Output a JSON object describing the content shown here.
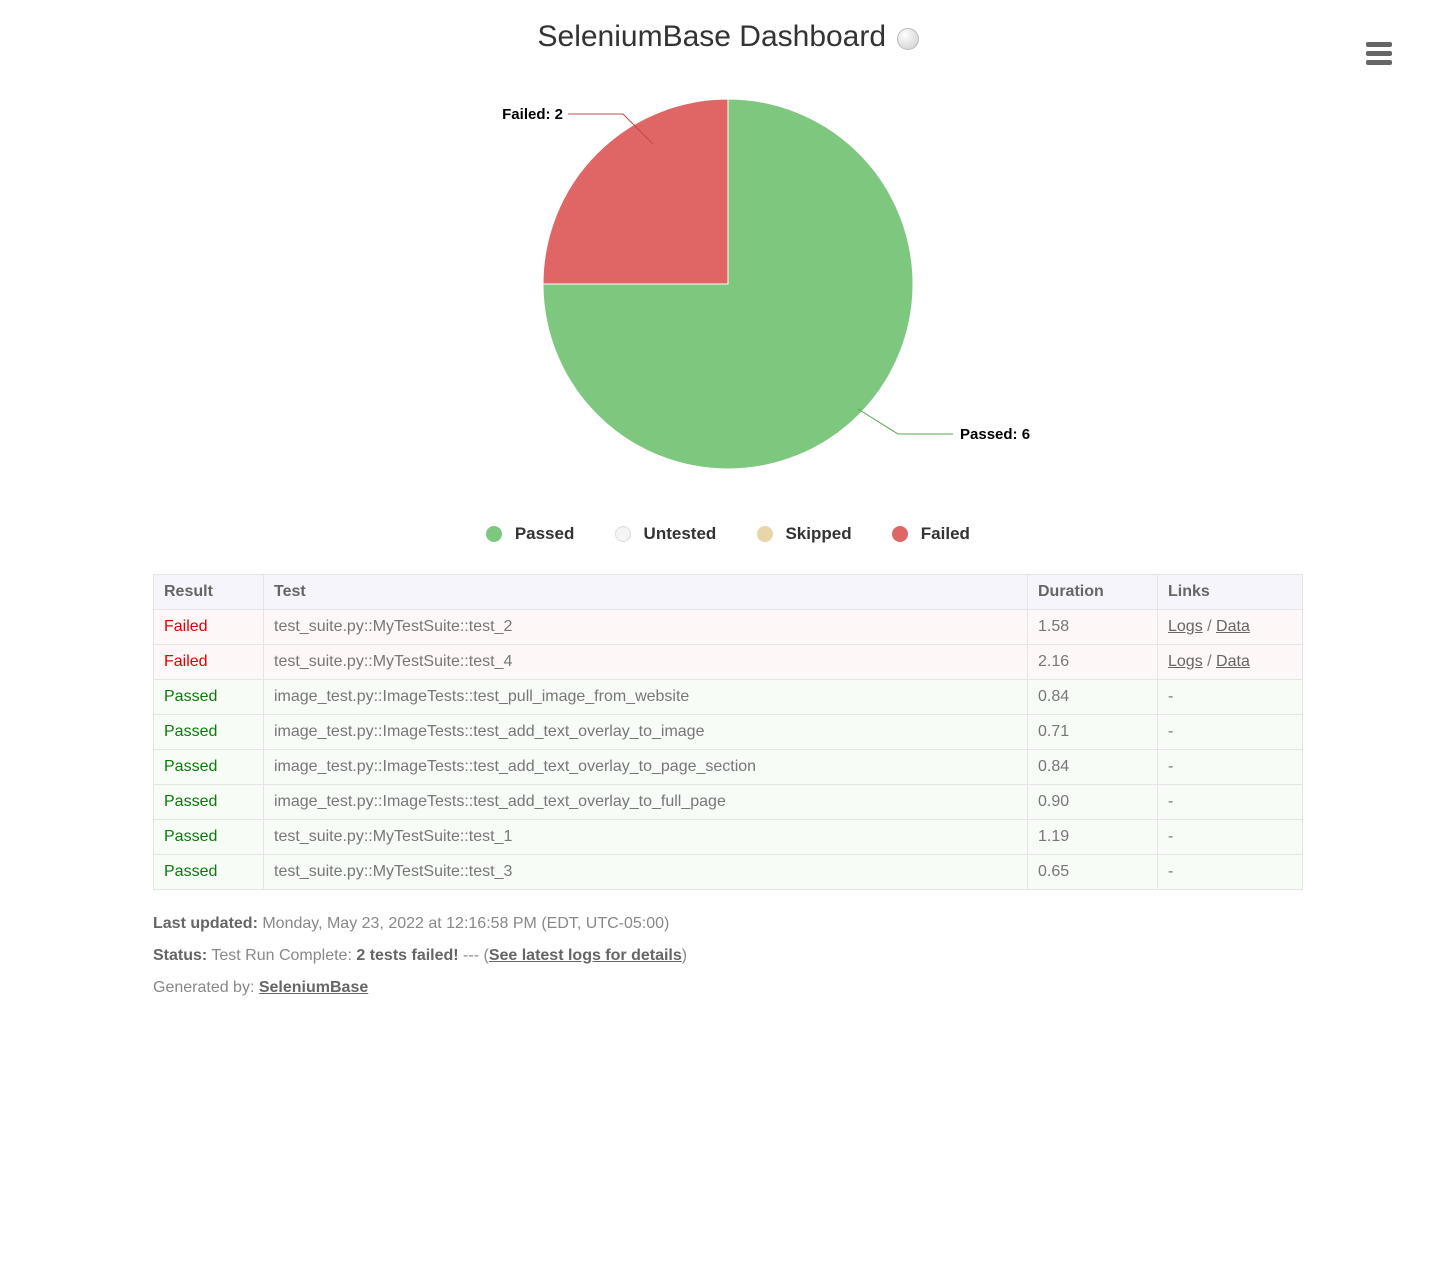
{
  "title": "SeleniumBase Dashboard",
  "chart_data": {
    "type": "pie",
    "title": "SeleniumBase Dashboard",
    "series": [
      {
        "name": "Passed",
        "value": 6,
        "color": "#7ec77e"
      },
      {
        "name": "Untested",
        "value": 0,
        "color": "#f4f4f4"
      },
      {
        "name": "Skipped",
        "value": 0,
        "color": "#e8d5a8"
      },
      {
        "name": "Failed",
        "value": 2,
        "color": "#e06666"
      }
    ],
    "labels": {
      "passed": "Passed: 6",
      "failed": "Failed: 2"
    }
  },
  "legend": {
    "passed": "Passed",
    "untested": "Untested",
    "skipped": "Skipped",
    "failed": "Failed"
  },
  "table": {
    "headers": {
      "result": "Result",
      "test": "Test",
      "duration": "Duration",
      "links": "Links"
    },
    "rows": [
      {
        "result": "Failed",
        "rclass": "failed",
        "test": "test_suite.py::MyTestSuite::test_2",
        "duration": "1.58",
        "links_logs": "Logs",
        "links_data": "Data"
      },
      {
        "result": "Failed",
        "rclass": "failed",
        "test": "test_suite.py::MyTestSuite::test_4",
        "duration": "2.16",
        "links_logs": "Logs",
        "links_data": "Data"
      },
      {
        "result": "Passed",
        "rclass": "passed",
        "test": "image_test.py::ImageTests::test_pull_image_from_website",
        "duration": "0.84",
        "links": "-"
      },
      {
        "result": "Passed",
        "rclass": "passed",
        "test": "image_test.py::ImageTests::test_add_text_overlay_to_image",
        "duration": "0.71",
        "links": "-"
      },
      {
        "result": "Passed",
        "rclass": "passed",
        "test": "image_test.py::ImageTests::test_add_text_overlay_to_page_section",
        "duration": "0.84",
        "links": "-"
      },
      {
        "result": "Passed",
        "rclass": "passed",
        "test": "image_test.py::ImageTests::test_add_text_overlay_to_full_page",
        "duration": "0.90",
        "links": "-"
      },
      {
        "result": "Passed",
        "rclass": "passed",
        "test": "test_suite.py::MyTestSuite::test_1",
        "duration": "1.19",
        "links": "-"
      },
      {
        "result": "Passed",
        "rclass": "passed",
        "test": "test_suite.py::MyTestSuite::test_3",
        "duration": "0.65",
        "links": "-"
      }
    ]
  },
  "footer": {
    "last_updated_label": "Last updated:",
    "last_updated_value": "Monday, May 23, 2022 at 12:16:58 PM (EDT, UTC-05:00)",
    "status_label": "Status:",
    "status_value_prefix": "Test Run Complete: ",
    "status_tests_failed": "2 tests failed!",
    "status_separator": " --- (",
    "status_link_text": "See latest logs for details",
    "status_suffix": ")",
    "generated_by_label": "Generated by:",
    "generated_by_link": "SeleniumBase"
  }
}
